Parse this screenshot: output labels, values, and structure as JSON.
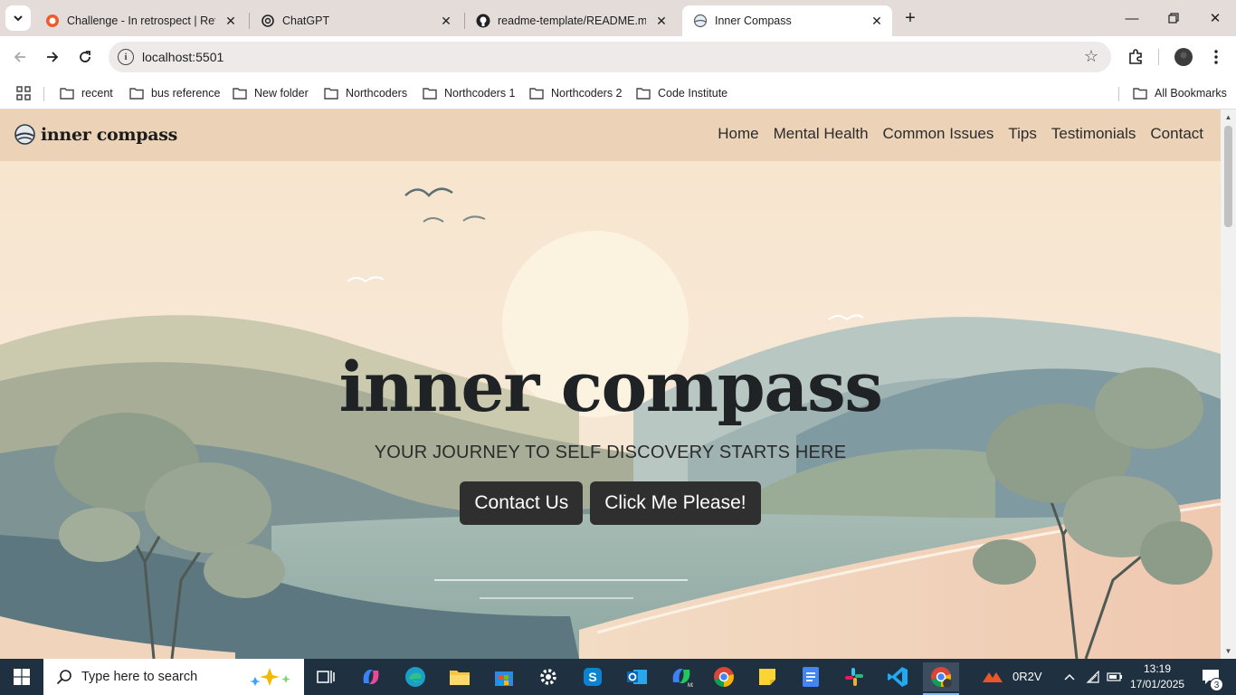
{
  "browser": {
    "tabs": [
      {
        "title": "Challenge - In retrospect | Retro",
        "icon": "retro-favicon-icon",
        "active": false
      },
      {
        "title": "ChatGPT",
        "icon": "chatgpt-favicon-icon",
        "active": false
      },
      {
        "title": "readme-template/README.md",
        "icon": "github-favicon-icon",
        "active": false
      },
      {
        "title": "Inner Compass",
        "icon": "compass-favicon-icon",
        "active": true
      }
    ],
    "url": "localhost:5501",
    "bookmarks": [
      "recent",
      "bus reference",
      "New folder",
      "Northcoders",
      "Northcoders 1",
      "Northcoders 2",
      "Code Institute"
    ],
    "all_bookmarks": "All Bookmarks"
  },
  "site": {
    "brand": "inner compass",
    "nav": [
      "Home",
      "Mental Health",
      "Common Issues",
      "Tips",
      "Testimonials",
      "Contact"
    ],
    "hero": {
      "title": "inner compass",
      "subtitle": "YOUR JOURNEY TO SELF DISCOVERY STARTS HERE",
      "buttons": [
        "Contact Us",
        "Click Me Please!"
      ]
    }
  },
  "taskbar": {
    "search_placeholder": "Type here to search",
    "tray_app": "0R2V",
    "time": "13:19",
    "date": "17/01/2025",
    "notifications": "3"
  },
  "colors": {
    "nav_bg": "#ecd3b8",
    "button_bg": "#2f2f2f",
    "taskbar_bg": "#1f3040"
  }
}
